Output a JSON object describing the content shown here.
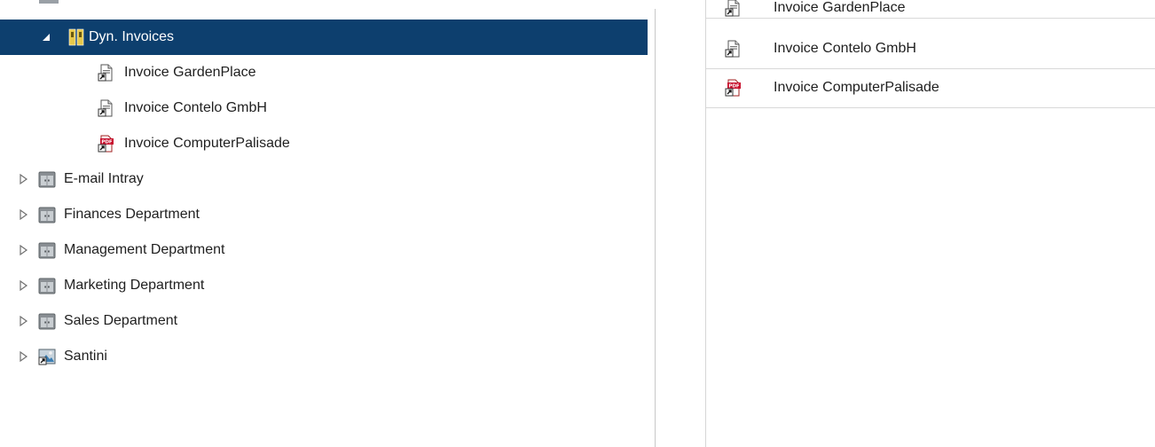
{
  "tree": {
    "items": [
      {
        "label": "Dyn. Invoices",
        "icon": "dynamic-folder-icon",
        "expanded": true,
        "selected": true
      },
      {
        "label": "Invoice GardenPlace",
        "icon": "document-shortcut-icon"
      },
      {
        "label": "Invoice Contelo GmbH",
        "icon": "document-shortcut-icon"
      },
      {
        "label": "Invoice ComputerPalisade",
        "icon": "pdf-shortcut-icon"
      },
      {
        "label": "E-mail Intray",
        "icon": "cabinet-icon"
      },
      {
        "label": "Finances Department",
        "icon": "cabinet-icon"
      },
      {
        "label": "Management Department",
        "icon": "cabinet-icon"
      },
      {
        "label": "Marketing Department",
        "icon": "cabinet-icon"
      },
      {
        "label": "Sales Department",
        "icon": "cabinet-icon"
      },
      {
        "label": "Santini",
        "icon": "image-shortcut-icon"
      }
    ]
  },
  "list": {
    "items": [
      {
        "label": "Invoice GardenPlace",
        "icon": "document-shortcut-icon"
      },
      {
        "label": "Invoice Contelo GmbH",
        "icon": "document-shortcut-icon"
      },
      {
        "label": "Invoice ComputerPalisade",
        "icon": "pdf-shortcut-icon"
      }
    ]
  },
  "colors": {
    "selection": "#0d3f6e",
    "pdf_red": "#c8102e",
    "cabinet_gray": "#8a8f94"
  }
}
